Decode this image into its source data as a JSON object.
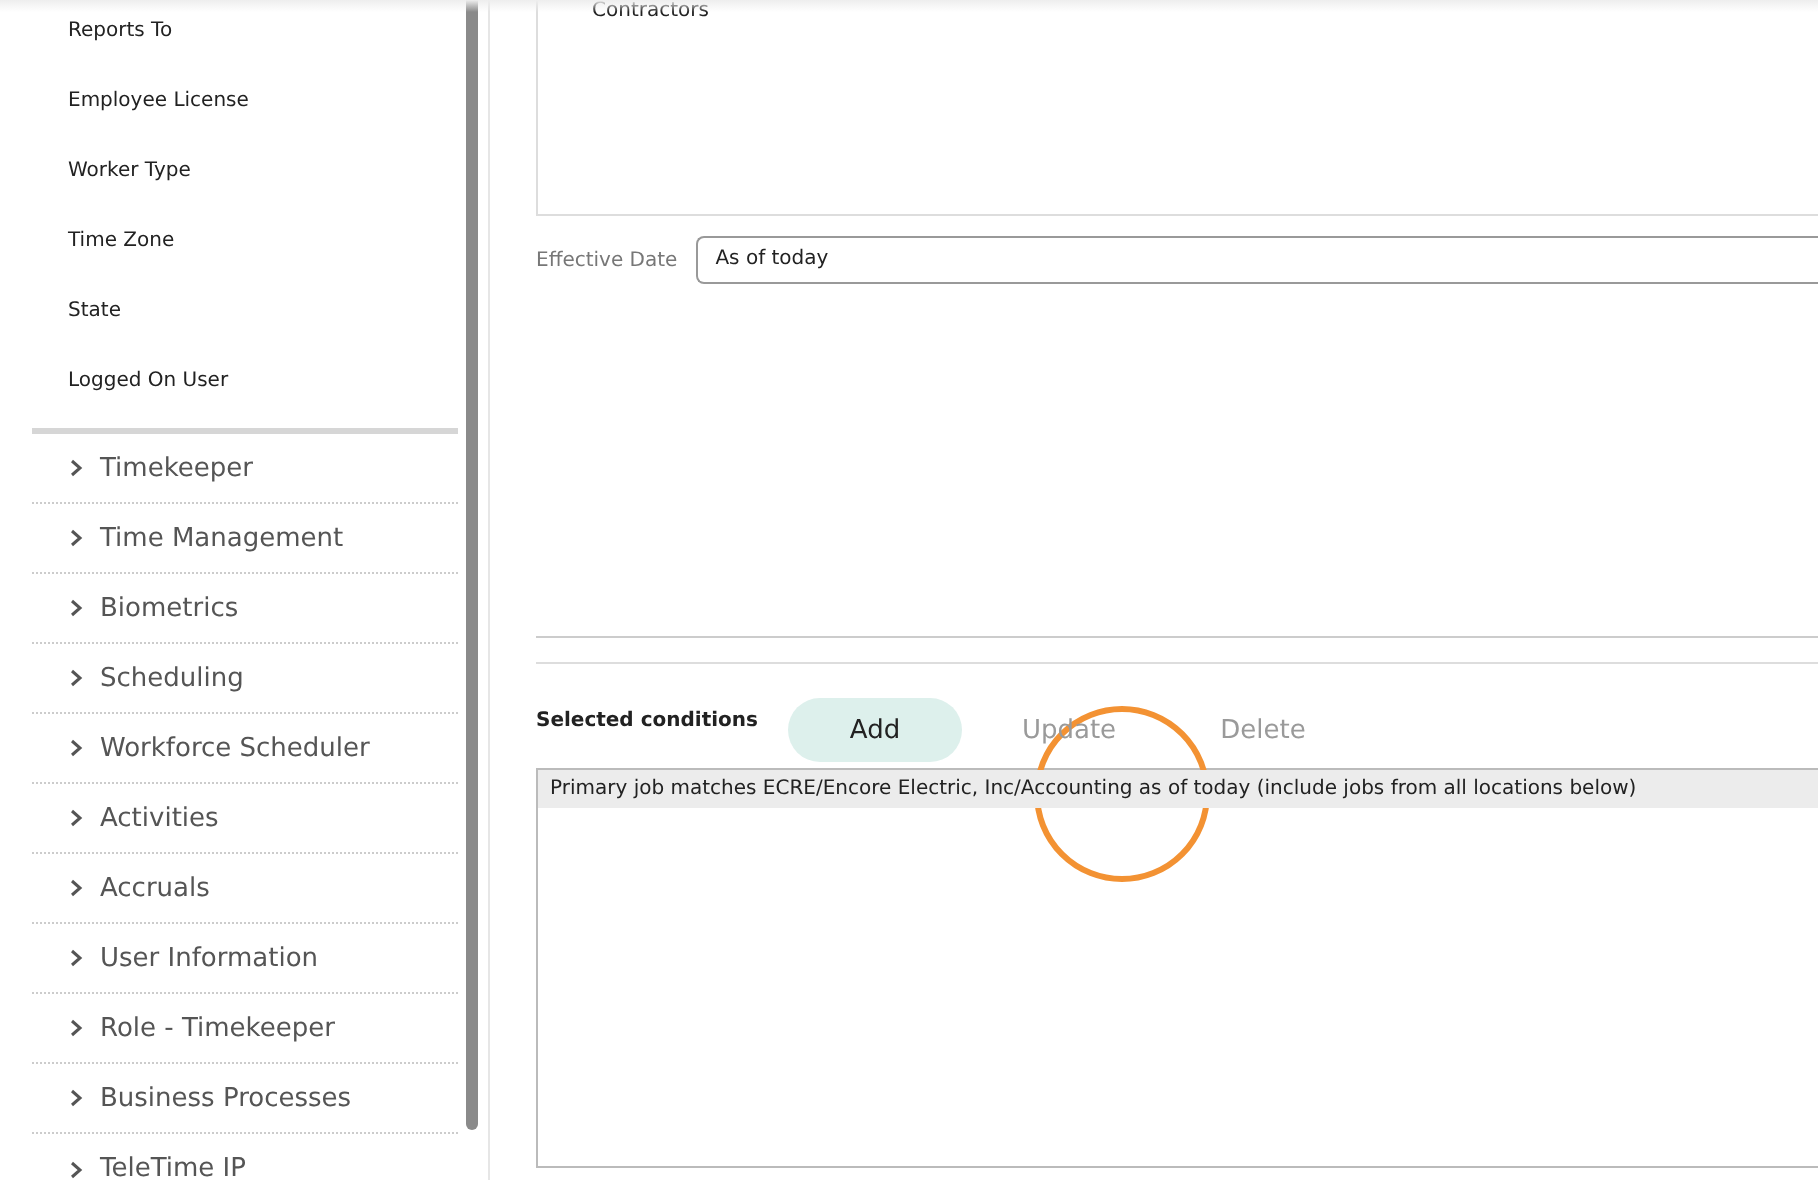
{
  "sidebar": {
    "fields": [
      {
        "label": "Reports To"
      },
      {
        "label": "Employee License"
      },
      {
        "label": "Worker Type"
      },
      {
        "label": "Time Zone"
      },
      {
        "label": "State"
      },
      {
        "label": "Logged On User"
      }
    ],
    "sections": [
      {
        "label": "Timekeeper",
        "expanded": false
      },
      {
        "label": "Time Management",
        "expanded": false
      },
      {
        "label": "Biometrics",
        "expanded": false
      },
      {
        "label": "Scheduling",
        "expanded": false
      },
      {
        "label": "Workforce Scheduler",
        "expanded": false
      },
      {
        "label": "Activities",
        "expanded": false
      },
      {
        "label": "Accruals",
        "expanded": false
      },
      {
        "label": "User Information",
        "expanded": false
      },
      {
        "label": "Role - Timekeeper",
        "expanded": false
      },
      {
        "label": "Business Processes",
        "expanded": false
      },
      {
        "label": "TeleTime IP",
        "expanded": false
      }
    ]
  },
  "value_list": {
    "items": [
      "Contractors"
    ]
  },
  "effective_date": {
    "label": "Effective Date",
    "value": "As of today"
  },
  "conditions": {
    "title": "Selected conditions",
    "buttons": [
      {
        "label": "Add",
        "disabled": false
      },
      {
        "label": "Update",
        "disabled": true
      },
      {
        "label": "Delete",
        "disabled": true
      }
    ],
    "items": [
      {
        "text": "Primary job matches ECRE/Encore Electric, Inc/Accounting as of today (include jobs from all locations below)",
        "selected": true
      }
    ]
  }
}
